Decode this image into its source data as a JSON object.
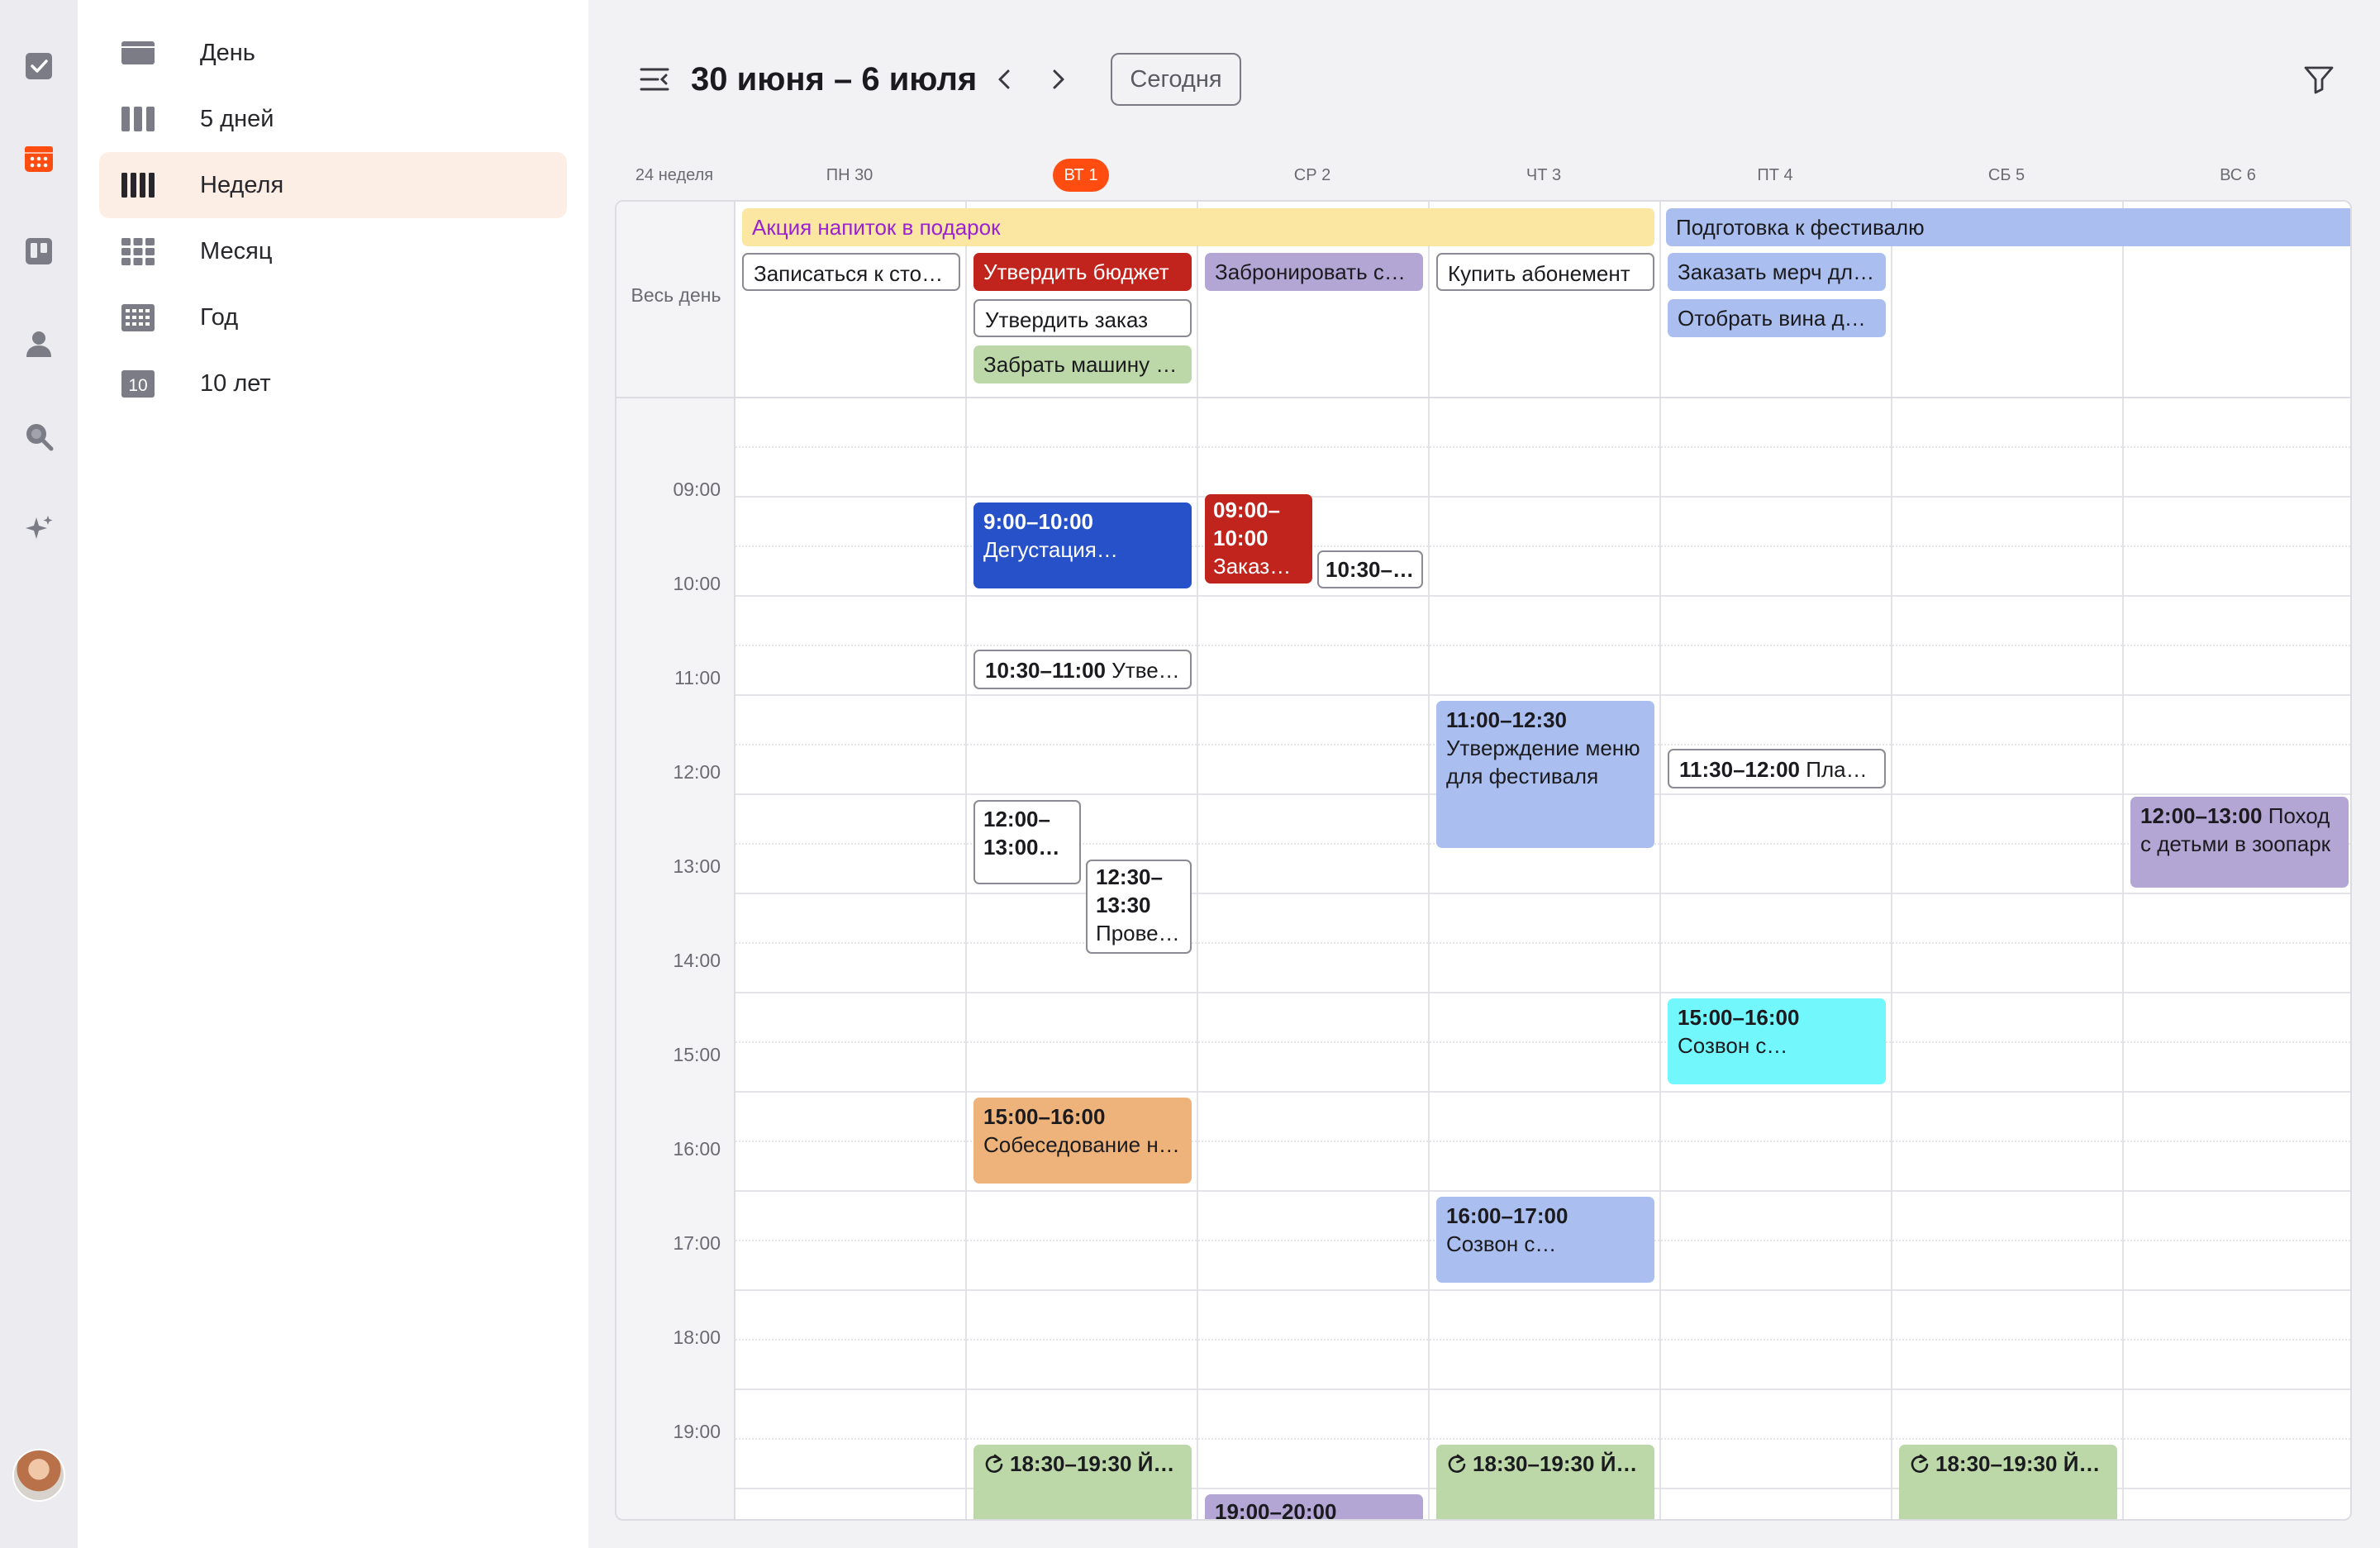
{
  "header": {
    "title": "30 июня – 6 июля",
    "today_label": "Сегодня"
  },
  "views": [
    {
      "label": "День",
      "icon": "day-view-icon"
    },
    {
      "label": "5 дней",
      "icon": "five-days-view-icon"
    },
    {
      "label": "Неделя",
      "icon": "week-view-icon",
      "active": true
    },
    {
      "label": "Месяц",
      "icon": "month-view-icon"
    },
    {
      "label": "Год",
      "icon": "year-view-icon"
    },
    {
      "label": "10 лет",
      "icon": "decade-view-icon",
      "badge": "10"
    }
  ],
  "rail": [
    "tasks-icon",
    "calendar-icon",
    "board-icon",
    "contacts-icon",
    "search-icon",
    "sparkle-icon"
  ],
  "calendar": {
    "week_label": "24 неделя",
    "all_day_label": "Весь день",
    "days": [
      "ПН 30",
      "ВТ 1",
      "СР 2",
      "ЧТ 3",
      "ПТ 4",
      "СБ 5",
      "ВС 6"
    ],
    "current_day_index": 1,
    "hours": [
      "09:00",
      "10:00",
      "11:00",
      "12:00",
      "13:00",
      "14:00",
      "15:00",
      "16:00",
      "17:00",
      "18:00",
      "19:00"
    ]
  },
  "colors": {
    "accent": "#ff4d12",
    "event_red": "#c0241c",
    "event_navy": "#2651c8",
    "event_blue": "#aabfef",
    "event_purple": "#b3a5d4",
    "event_green": "#bcd8a8",
    "event_orange": "#eeb37a",
    "event_cyan": "#72f8fc",
    "event_yellow": "#fbe6a2",
    "event_yellow_text": "#9a22d4"
  },
  "all_day_events": {
    "promo": "Акция напиток в подарок",
    "festival": "Подготовка к фестивалю",
    "mon_1": "Записаться к стоматологу",
    "tue_1": "Утвердить бюджет",
    "tue_2": "Утвердить заказ",
    "tue_3": "Забрать машину из сервиса",
    "wed_1": "Забронировать столик",
    "thu_1": "Купить абонемент",
    "fri_1": "Заказать мерч для фестиваля",
    "fri_2": "Отобрать вина для фестиваля"
  },
  "timed_events": {
    "tasting": {
      "time": "9:00–10:00",
      "title": "Дегустация…"
    },
    "order": {
      "time_a": "09:00–",
      "time_b": "10:00",
      "title": "Заказ…"
    },
    "wed_1030": {
      "time": "10:30–…"
    },
    "approve": {
      "time": "10:30–11:00",
      "title": "Утве…"
    },
    "menu": {
      "time": "11:00–12:30",
      "title": "Утверждение меню для фестиваля"
    },
    "plan": {
      "time": "11:30–12:00",
      "title": "План…"
    },
    "zoo": {
      "time": "12:00–13:00",
      "title": "Поход с детьми в зоопарк"
    },
    "tue_12": {
      "time_a": "12:00–",
      "time_b": "13:00…"
    },
    "check": {
      "time_a": "12:30–",
      "time_b": "13:30",
      "title": "Прове…"
    },
    "call_fri": {
      "time": "15:00–16:00",
      "title": "Созвон с…"
    },
    "interview": {
      "time": "15:00–16:00",
      "title": "Собеседование н…"
    },
    "call_thu": {
      "time": "16:00–17:00",
      "title": "Созвон с…"
    },
    "yoga_tue": {
      "time": "18:30–19:30",
      "title": "Й…"
    },
    "yoga_thu": {
      "time": "18:30–19:30",
      "title": "Й…"
    },
    "yoga_sat": {
      "time": "18:30–19:30",
      "title": "Й…"
    },
    "wed_19": {
      "time": "19:00–20:00"
    }
  }
}
